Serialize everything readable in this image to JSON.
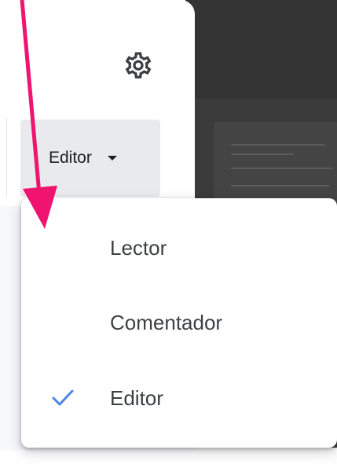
{
  "role_selector": {
    "current_value": "Editor"
  },
  "role_menu": {
    "items": [
      {
        "label": "Lector",
        "selected": false
      },
      {
        "label": "Comentador",
        "selected": false
      },
      {
        "label": "Editor",
        "selected": true
      }
    ]
  },
  "icons": {
    "settings": "gear-icon",
    "dropdown": "caret-down-icon",
    "selected": "check-icon"
  },
  "colors": {
    "annotation_arrow": "#f0136f",
    "check": "#4a86e8",
    "button_background": "#e8eaed",
    "backdrop": "#3b3b3b"
  }
}
